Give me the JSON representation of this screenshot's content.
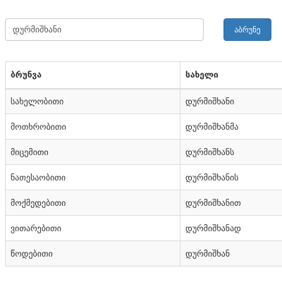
{
  "search": {
    "value": "დურმიშხანი",
    "button_label": "აბრუნე"
  },
  "table": {
    "headers": [
      "ბრუნვა",
      "სახელი"
    ],
    "rows": [
      [
        "სახელობითი",
        "დურმიშხანი"
      ],
      [
        "მოთხრობითი",
        "დურმიშხანმა"
      ],
      [
        "მიცემითი",
        "დურმიშხანს"
      ],
      [
        "ნათესაობითი",
        "დურმიშხანის"
      ],
      [
        "მოქმედებითი",
        "დურმიშხანით"
      ],
      [
        "ვითარებითი",
        "დურმიშხანად"
      ],
      [
        "წოდებითი",
        "დურმიშხან"
      ]
    ]
  },
  "colors": {
    "button_bg": "#337ab7",
    "border": "#dddddd",
    "stripe": "#f9f9f9"
  }
}
